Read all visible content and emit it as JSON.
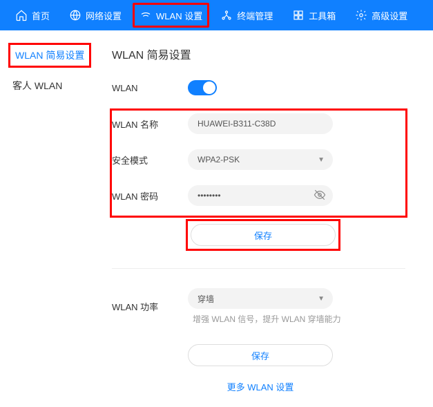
{
  "nav": {
    "items": [
      {
        "label": "首页",
        "icon": "home"
      },
      {
        "label": "网络设置",
        "icon": "globe"
      },
      {
        "label": "WLAN 设置",
        "icon": "wifi",
        "highlight": true
      },
      {
        "label": "终端管理",
        "icon": "nodes"
      },
      {
        "label": "工具箱",
        "icon": "tools"
      },
      {
        "label": "高级设置",
        "icon": "gear"
      }
    ]
  },
  "sidebar": {
    "items": [
      {
        "label": "WLAN 简易设置",
        "active": true,
        "highlight": true
      },
      {
        "label": "客人 WLAN"
      }
    ]
  },
  "page": {
    "title": "WLAN 简易设置"
  },
  "form": {
    "wlan_label": "WLAN",
    "wlan_on": true,
    "name_label": "WLAN 名称",
    "name_value": "HUAWEI-B311-C38D",
    "security_label": "安全模式",
    "security_value": "WPA2-PSK",
    "password_label": "WLAN 密码",
    "password_value": "••••••••",
    "save1_label": "保存"
  },
  "power": {
    "label": "WLAN 功率",
    "value": "穿墙",
    "hint": "增强 WLAN 信号，提升 WLAN 穿墙能力",
    "save_label": "保存"
  },
  "more_link": "更多 WLAN 设置"
}
